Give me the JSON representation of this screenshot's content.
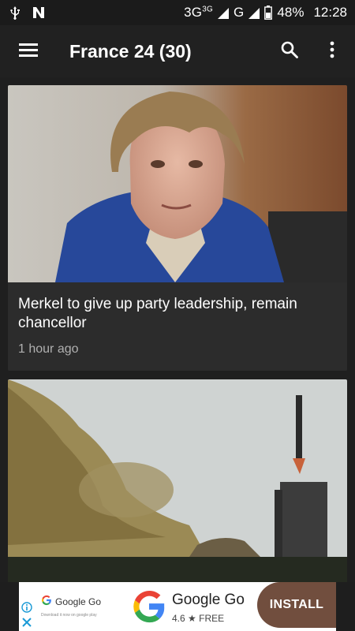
{
  "status_bar": {
    "network": "3G",
    "network_sup": "3G",
    "network2": "G",
    "battery": "48%",
    "time": "12:28",
    "icons": [
      "usb-icon",
      "n-notification-icon",
      "signal-icon",
      "battery-icon"
    ]
  },
  "app_bar": {
    "title": "France 24 (30)",
    "icons": [
      "menu-icon",
      "search-icon",
      "more-vert-icon"
    ]
  },
  "articles": [
    {
      "title": "Merkel to give up party leadership, remain chancellor",
      "time": "1 hour ago"
    },
    {
      "title": "",
      "time": ""
    }
  ],
  "ad": {
    "mini_label": "Google Go",
    "fine_print": "Download it now on google play",
    "app_name": "Google Go",
    "rating": "4.6 ★ FREE",
    "install_label": "INSTALL",
    "colors": {
      "install_bg": "#714e3e",
      "g_blue": "#4285F4",
      "g_red": "#EA4335",
      "g_yellow": "#FBBC05",
      "g_green": "#34A853"
    }
  }
}
